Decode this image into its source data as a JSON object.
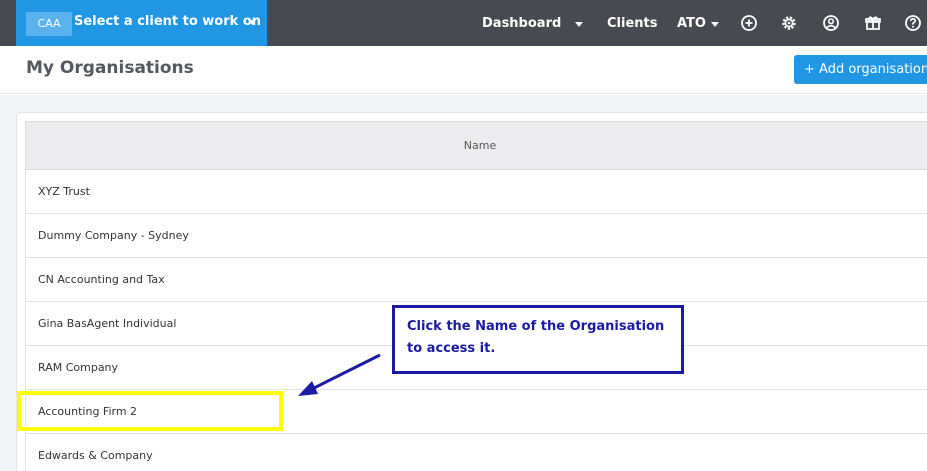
{
  "topbar": {
    "client_badge": "CAA",
    "client_select_label": "Select a client to work on",
    "nav_dashboard": "Dashboard",
    "nav_clients": "Clients",
    "nav_ato": "ATO"
  },
  "header": {
    "title": "My Organisations",
    "add_button": "+ Add organisation"
  },
  "table": {
    "column_name": "Name",
    "rows": [
      "XYZ Trust",
      "Dummy Company - Sydney",
      "CN Accounting and Tax",
      "Gina BasAgent Individual",
      "RAM Company",
      "Accounting Firm 2",
      "Edwards & Company"
    ]
  },
  "annotation": {
    "callout_line1": "Click the Name of the Organisation",
    "callout_line2": "to access it."
  },
  "icons": [
    "plus-circle-icon",
    "gear-icon",
    "user-circle-icon",
    "gift-icon",
    "help-icon"
  ],
  "colors": {
    "topbar": "#474a50",
    "accent": "#2196e3",
    "highlight": "#ffff00",
    "callout": "#1a1aa3"
  }
}
